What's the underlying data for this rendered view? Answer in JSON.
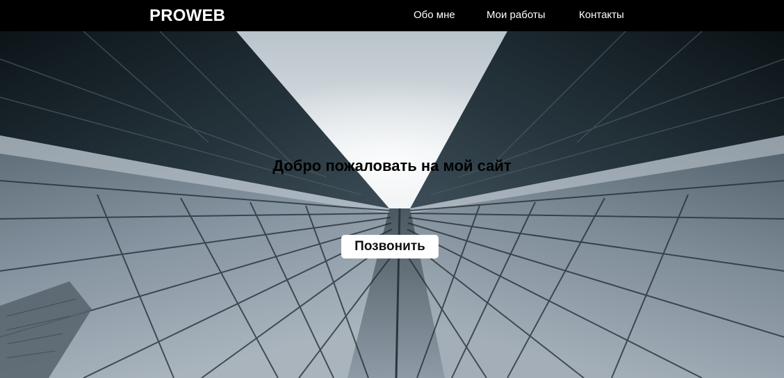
{
  "header": {
    "logo": "PROWEB",
    "nav": [
      {
        "label": "Обо мне"
      },
      {
        "label": "Мои работы"
      },
      {
        "label": "Контакты"
      }
    ]
  },
  "hero": {
    "title": "Добро пожаловать на мой сайт",
    "button_label": "Позвонить",
    "background": "low-angle photo of glass skyscrapers against a cloudy sky"
  },
  "colors": {
    "header_bg": "#000000",
    "header_text": "#ffffff",
    "button_bg": "#ffffff",
    "title_text": "#000000"
  }
}
